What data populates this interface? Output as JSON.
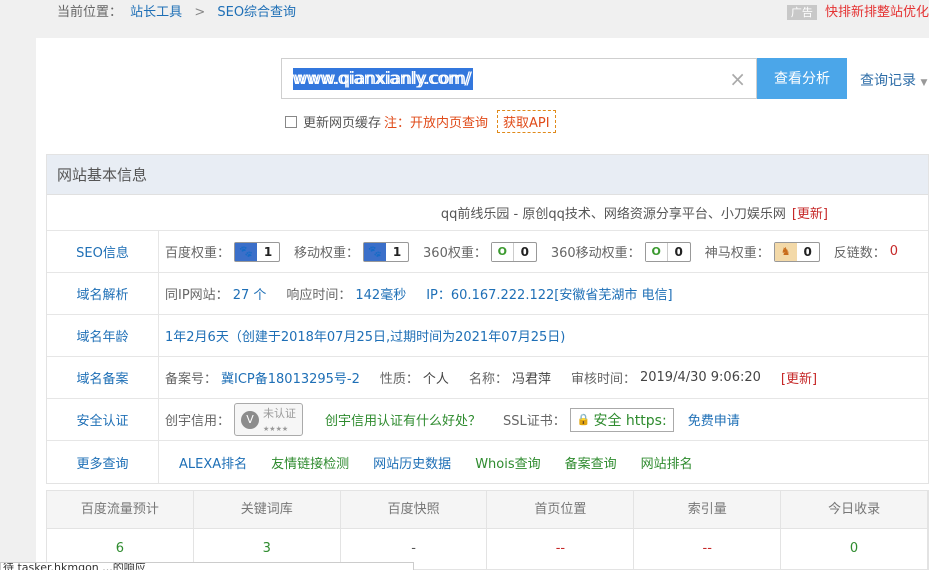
{
  "breadcrumb": {
    "prefix": "当前位置：",
    "site_tools": "站长工具",
    "sep": ">",
    "current": "SEO综合查询"
  },
  "ad": {
    "tag": "广告",
    "text": "快排新排整站优化"
  },
  "search": {
    "value": "www.qianxianly.com/",
    "clear_icon": "×",
    "analyze_label": "查看分析",
    "history_label": "查询记录",
    "history_caret": "▼"
  },
  "options": {
    "refresh_label": "更新网页缓存",
    "note": "注：开放内页查询",
    "api_label": "获取API"
  },
  "panel": {
    "title": "网站基本信息",
    "site_title": "qq前线乐园 - 原创qq技术、网络资源分享平台、小刀娱乐网",
    "site_update": "[更新]",
    "seo": {
      "label": "SEO信息",
      "baidu_k": "百度权重：",
      "baidu_v": "1",
      "mobile_k": "移动权重：",
      "mobile_v": "1",
      "s360_k": "360权重：",
      "s360_v": "0",
      "s360m_k": "360移动权重：",
      "s360m_v": "0",
      "shenma_k": "神马权重：",
      "shenma_v": "0",
      "backlinks_k": "反链数：",
      "backlinks_v": "0"
    },
    "dns": {
      "label": "域名解析",
      "same_ip_k": "同IP网站：",
      "same_ip_v": "27 个",
      "resp_k": "响应时间：",
      "resp_v": "142毫秒",
      "ip_v": "IP：60.167.222.122[安徽省芜湖市 电信]"
    },
    "age": {
      "label": "域名年龄",
      "text": "1年2月6天（创建于2018年07月25日,过期时间为2021年07月25日)"
    },
    "beian": {
      "label": "域名备案",
      "no_k": "备案号：",
      "no_v": "冀ICP备18013295号-2",
      "nature_k": "性质：",
      "nature_v": "个人",
      "name_k": "名称：",
      "name_v": "冯君萍",
      "time_k": "审核时间：",
      "time_v": "2019/4/30 9:06:20",
      "update": "[更新]"
    },
    "security": {
      "label": "安全认证",
      "credit_k": "创宇信用：",
      "cert_text": "未认证",
      "cert_icon": "V",
      "cert_stars": "★★★★",
      "benefit_link": "创宇信用认证有什么好处？",
      "ssl_k": "SSL证书：",
      "ssl_icon": "🔒",
      "ssl_text": "安全 https:",
      "free_apply": "免费申请"
    },
    "more": {
      "label": "更多查询",
      "links": [
        "ALEXA排名",
        "友情链接检测",
        "网站历史数据",
        "Whois查询",
        "备案查询",
        "网站排名"
      ]
    }
  },
  "stats": {
    "headers": [
      "百度流量预计",
      "关键词库",
      "百度快照",
      "首页位置",
      "索引量",
      "今日收录"
    ],
    "values": [
      "6",
      "3",
      "-",
      "--",
      "--",
      "0"
    ]
  },
  "status_bar": {
    "text": "待 tasker.hkmqon ...的响应"
  },
  "colors": {
    "accent": "#4ba6e9",
    "link": "#1e6fb6",
    "alert": "#c62828",
    "ok": "#2e8b2e"
  }
}
